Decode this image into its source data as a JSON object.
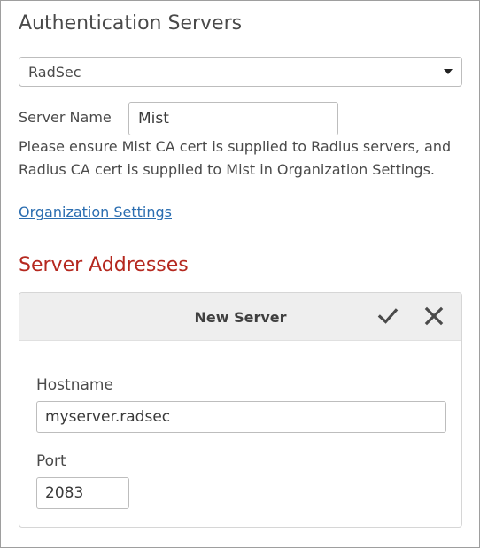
{
  "header": {
    "title": "Authentication Servers"
  },
  "server_type": {
    "selected": "RadSec"
  },
  "server_name": {
    "label": "Server Name",
    "value": "Mist"
  },
  "notice": "Please ensure Mist CA cert is supplied to Radius servers, and Radius CA cert is supplied to Mist in Organization Settings.",
  "org_link": "Organization Settings",
  "addresses": {
    "title": "Server Addresses",
    "card_title": "New Server",
    "confirm_icon": "checkmark-icon",
    "cancel_icon": "close-icon",
    "hostname": {
      "label": "Hostname",
      "value": "myserver.radsec"
    },
    "port": {
      "label": "Port",
      "value": "2083"
    }
  },
  "colors": {
    "section_title": "#b5281f",
    "link": "#2a6db0",
    "card_header_bg": "#eeeeee"
  }
}
